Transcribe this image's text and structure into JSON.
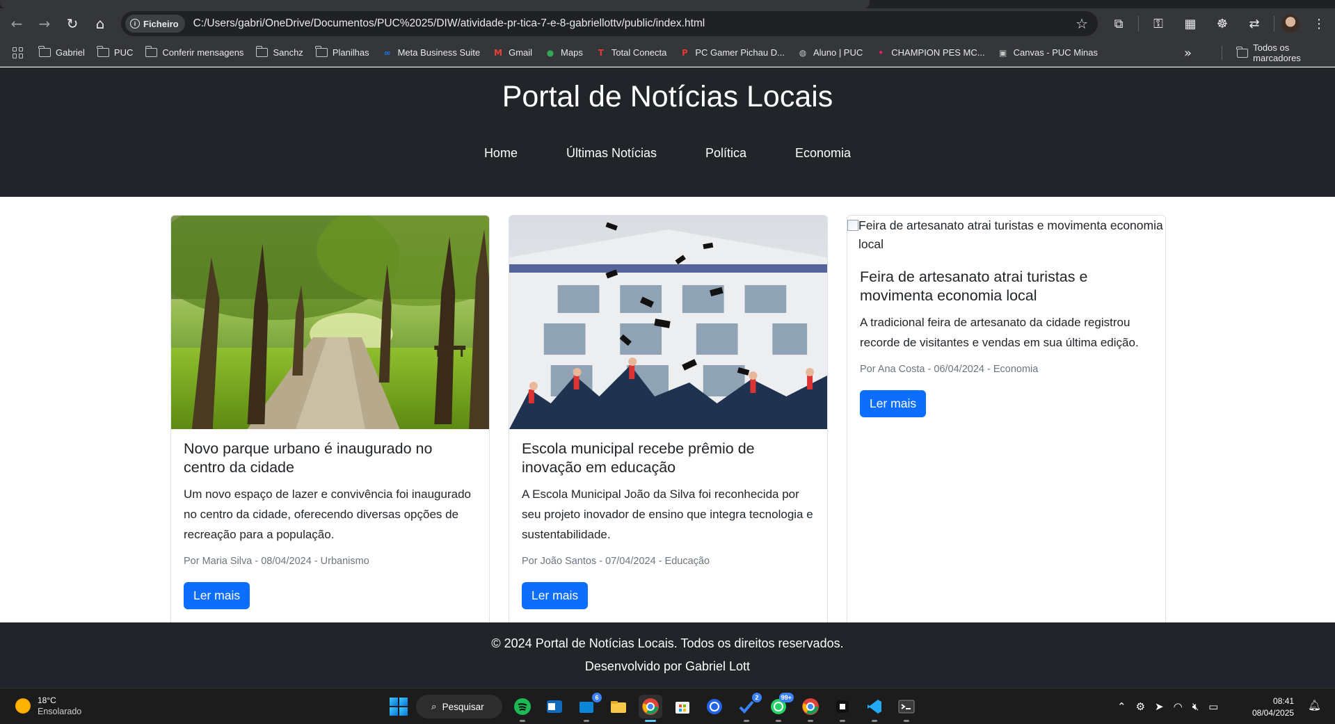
{
  "browser": {
    "chip_label": "Ficheiro",
    "url": "C:/Users/gabri/OneDrive/Documentos/PUC%2025/DIW/atividade-pr-tica-7-e-8-gabriellottv/public/index.html",
    "bookmarks": [
      {
        "label": "Gabriel",
        "icon": "folder-icon"
      },
      {
        "label": "PUC",
        "icon": "folder-icon"
      },
      {
        "label": "Conferir mensagens",
        "icon": "folder-icon"
      },
      {
        "label": "Sanchz",
        "icon": "folder-icon"
      },
      {
        "label": "Planilhas",
        "icon": "folder-icon"
      },
      {
        "label": "Meta Business Suite",
        "icon": "meta-icon"
      },
      {
        "label": "Gmail",
        "icon": "gmail-icon"
      },
      {
        "label": "Maps",
        "icon": "maps-icon"
      },
      {
        "label": "Total Conecta",
        "icon": "total-conecta-icon"
      },
      {
        "label": "PC Gamer Pichau D...",
        "icon": "pichau-icon"
      },
      {
        "label": "Aluno | PUC",
        "icon": "globe-icon"
      },
      {
        "label": "CHAMPION PES MC...",
        "icon": "champion-icon"
      },
      {
        "label": "Canvas - PUC Minas",
        "icon": "canvas-icon"
      }
    ],
    "all_bookmarks_label": "Todos os marcadores"
  },
  "site": {
    "title": "Portal de Notícias Locais",
    "nav": [
      "Home",
      "Últimas Notícias",
      "Política",
      "Economia"
    ]
  },
  "cards": [
    {
      "image_alt": "",
      "image_loaded": true,
      "title": "Novo parque urbano é inaugurado no centro da cidade",
      "text": "Um novo espaço de lazer e convivência foi inaugurado no centro da cidade, oferecendo diversas opções de recreação para a população.",
      "meta": "Por Maria Silva - 08/04/2024 - Urbanismo",
      "button": "Ler mais"
    },
    {
      "image_alt": "",
      "image_loaded": true,
      "title": "Escola municipal recebe prêmio de inovação em educação",
      "text": "A Escola Municipal João da Silva foi reconhecida por seu projeto inovador de ensino que integra tecnologia e sustentabilidade.",
      "meta": "Por João Santos - 07/04/2024 - Educação",
      "button": "Ler mais"
    },
    {
      "image_alt": "Feira de artesanato atrai turistas e movimenta economia local",
      "image_loaded": false,
      "title": "Feira de artesanato atrai turistas e movimenta economia local",
      "text": "A tradicional feira de artesanato da cidade registrou recorde de visitantes e vendas em sua última edição.",
      "meta": "Por Ana Costa - 06/04/2024 - Economia",
      "button": "Ler mais"
    }
  ],
  "footer": {
    "line1": "© 2024 Portal de Notícias Locais. Todos os direitos reservados.",
    "line2": "Desenvolvido por Gabriel Lott"
  },
  "taskbar": {
    "weather_temp": "18°C",
    "weather_desc": "Ensolarado",
    "search_label": "Pesquisar",
    "badges": {
      "store": "6",
      "todo": "2",
      "whatsapp": "99+"
    },
    "time": "08:41",
    "date": "08/04/2025"
  },
  "colors": {
    "header_bg": "#212529",
    "button_bg": "#0d6efd",
    "browser_bg": "#35363a"
  }
}
